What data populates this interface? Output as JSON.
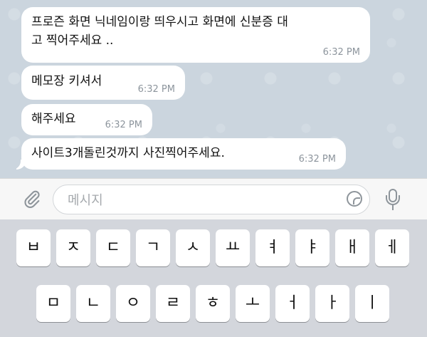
{
  "messages": [
    {
      "text_line1": "프로즌 화면 닉네임이랑 띄우시고 화면에 신분증 대",
      "text_line2": "고 찍어주세요 ..",
      "time": "6:32 PM"
    },
    {
      "text": "메모장 키셔서",
      "time": "6:32 PM"
    },
    {
      "text": "해주세요",
      "time": "6:32 PM"
    },
    {
      "text": "사이트3개돌린것까지 사진찍어주세요.",
      "time": "6:32 PM"
    }
  ],
  "input": {
    "placeholder": "메시지",
    "attach_icon": "paperclip-icon",
    "sticker_icon": "sticker-icon",
    "mic_icon": "microphone-icon"
  },
  "keyboard": {
    "row1": [
      "ㅂ",
      "ㅈ",
      "ㄷ",
      "ㄱ",
      "ㅅ",
      "ㅛ",
      "ㅕ",
      "ㅑ",
      "ㅐ",
      "ㅔ"
    ],
    "row2": [
      "ㅁ",
      "ㄴ",
      "ㅇ",
      "ㄹ",
      "ㅎ",
      "ㅗ",
      "ㅓ",
      "ㅏ",
      "ㅣ"
    ]
  },
  "colors": {
    "chat_background": "#cbd5de",
    "bubble": "#ffffff",
    "timestamp": "#8d959d",
    "keyboard_background": "#d3d6dc"
  }
}
